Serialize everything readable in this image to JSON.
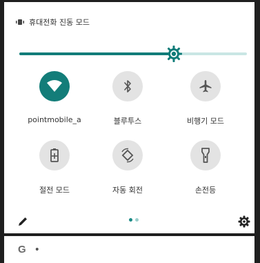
{
  "status_bar": {
    "text": "휴대전화 진동 모드",
    "vibrate_icon": "vibrate-icon"
  },
  "brightness": {
    "level": 0.68,
    "icon": "brightness-icon"
  },
  "tiles": [
    {
      "label": "pointmobile_a",
      "icon": "wifi-icon",
      "active": true
    },
    {
      "label": "블루투스",
      "icon": "bluetooth-icon",
      "active": false
    },
    {
      "label": "비행기 모드",
      "icon": "airplane-icon",
      "active": false
    },
    {
      "label": "절전 모드",
      "icon": "battery-saver-icon",
      "active": false
    },
    {
      "label": "자동 회전",
      "icon": "auto-rotate-icon",
      "active": false
    },
    {
      "label": "손전등",
      "icon": "flashlight-icon",
      "active": false
    }
  ],
  "footer": {
    "edit_icon": "edit-icon",
    "settings_icon": "settings-icon",
    "page_count": 2,
    "active_page": 1
  },
  "search_bar": {
    "logo_text": "G",
    "dot_text": "•"
  },
  "colors": {
    "accent": "#137d79",
    "tile_inactive": "#e3e3e3",
    "track": "#c9e6e4"
  }
}
